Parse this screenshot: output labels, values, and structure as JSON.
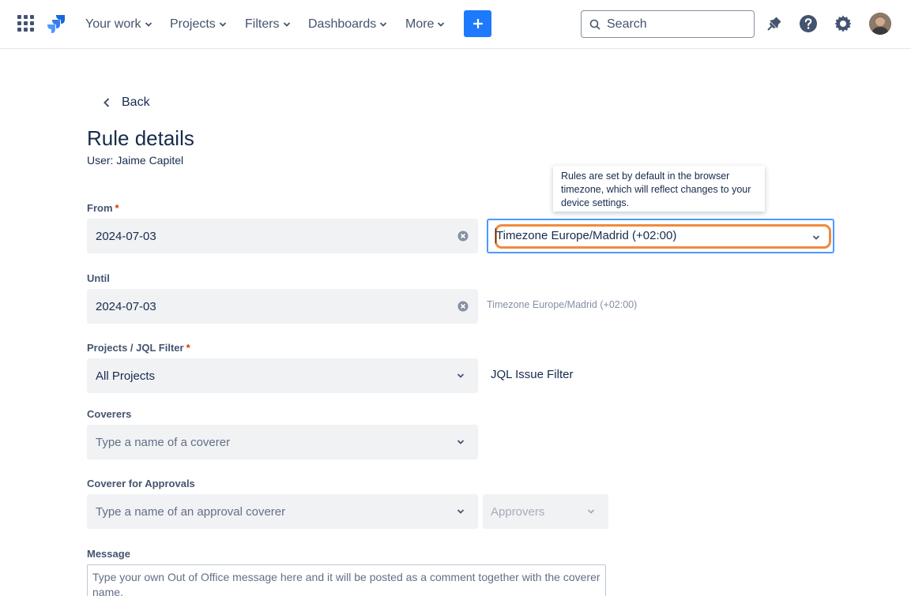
{
  "nav": {
    "items": [
      {
        "label": "Your work"
      },
      {
        "label": "Projects"
      },
      {
        "label": "Filters"
      },
      {
        "label": "Dashboards"
      },
      {
        "label": "More"
      }
    ],
    "search_placeholder": "Search",
    "accent": "#1d7afc",
    "icons": [
      "app-switcher-icon",
      "jira-logo-icon",
      "plus-icon",
      "search-icon",
      "notification-icon",
      "help-icon",
      "settings-icon"
    ]
  },
  "page": {
    "back_label": "Back",
    "title": "Rule details",
    "user_line": "User: Jaime Capitel"
  },
  "form": {
    "from": {
      "label": "From",
      "required_mark": "*",
      "value": "2024-07-03"
    },
    "timezone_select": {
      "value": "Timezone Europe/Madrid (+02:00)"
    },
    "tooltip": "Rules are set by default in the browser timezone, which will reflect changes to your device settings.",
    "until": {
      "label": "Until",
      "value": "2024-07-03",
      "timezone_text": "Timezone Europe/Madrid (+02:00)"
    },
    "projects": {
      "label": "Projects / JQL Filter",
      "required_mark": "*",
      "value": "All Projects",
      "jql_link": "JQL Issue Filter"
    },
    "coverers": {
      "label": "Coverers",
      "placeholder": "Type a name of a coverer"
    },
    "approval_coverer": {
      "label": "Coverer for Approvals",
      "placeholder": "Type a name of an approval coverer",
      "approvers_placeholder": "Approvers"
    },
    "message": {
      "label": "Message",
      "placeholder": "Type your own Out of Office message here and it will be posted as a comment together with the coverer name."
    }
  }
}
